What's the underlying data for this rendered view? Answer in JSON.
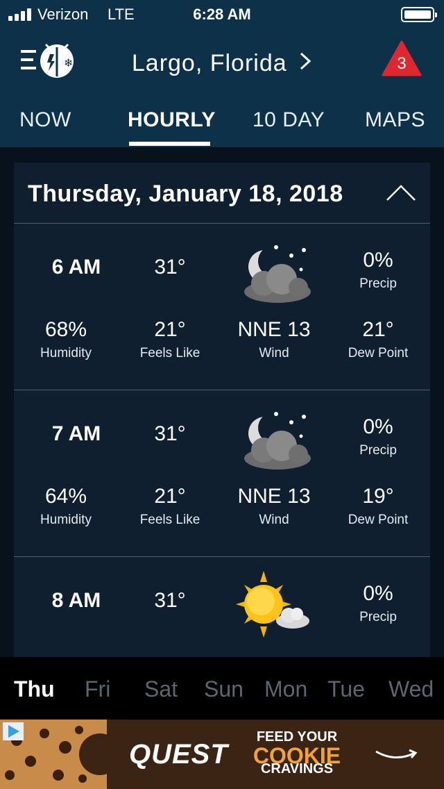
{
  "status_bar": {
    "carrier": "Verizon",
    "network": "LTE",
    "time": "6:28 AM"
  },
  "header": {
    "location": "Largo, Florida",
    "alert_count": "3"
  },
  "tabs": [
    {
      "label": "NOW",
      "active": false
    },
    {
      "label": "HOURLY",
      "active": true
    },
    {
      "label": "10 DAY",
      "active": false
    },
    {
      "label": "MAPS",
      "active": false
    }
  ],
  "hourly": {
    "date_title": "Thursday, January 18, 2018",
    "hours": [
      {
        "time": "6 AM",
        "temp": "31°",
        "icon": "night-partly-cloudy-icon",
        "precip": "0%",
        "precip_label": "Precip",
        "humidity": "68%",
        "humidity_label": "Humidity",
        "feels_like": "21°",
        "feels_like_label": "Feels Like",
        "wind": "NNE 13",
        "wind_label": "Wind",
        "dew_point": "21°",
        "dew_point_label": "Dew Point"
      },
      {
        "time": "7 AM",
        "temp": "31°",
        "icon": "night-partly-cloudy-icon",
        "precip": "0%",
        "precip_label": "Precip",
        "humidity": "64%",
        "humidity_label": "Humidity",
        "feels_like": "21°",
        "feels_like_label": "Feels Like",
        "wind": "NNE 13",
        "wind_label": "Wind",
        "dew_point": "19°",
        "dew_point_label": "Dew Point"
      },
      {
        "time": "8 AM",
        "temp": "31°",
        "icon": "sun-mostly-sunny-icon",
        "precip": "0%",
        "precip_label": "Precip"
      }
    ]
  },
  "days": [
    {
      "label": "Thu",
      "active": true
    },
    {
      "label": "Fri",
      "active": false
    },
    {
      "label": "Sat",
      "active": false
    },
    {
      "label": "Sun",
      "active": false
    },
    {
      "label": "Mon",
      "active": false
    },
    {
      "label": "Tue",
      "active": false
    },
    {
      "label": "Wed",
      "active": false
    }
  ],
  "ad": {
    "brand": "QUEST",
    "line1": "FEED YOUR",
    "line2": "COOKIE",
    "line3": "CRAVINGS"
  },
  "colors": {
    "header_bg": "#0c3148",
    "alert_red": "#e0262f",
    "ad_accent": "#f3a23a"
  }
}
